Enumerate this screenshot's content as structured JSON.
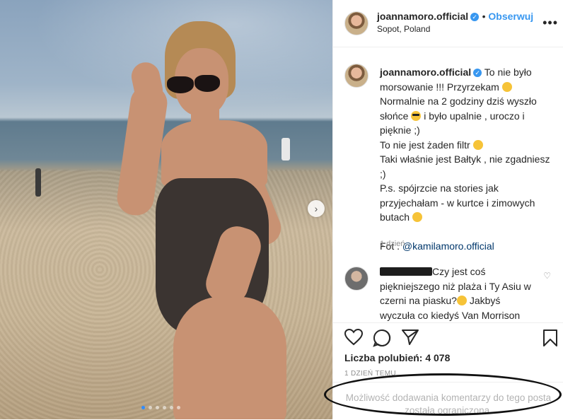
{
  "post": {
    "username": "joannamoro.official",
    "verified_mark": "✓",
    "follow_label": "Obserwuj",
    "location": "Sopot, Poland",
    "more_label": "•••"
  },
  "caption": {
    "username": "joannamoro.official",
    "line1": "To nie było morsowanie !!! Przyrzekam",
    "line2a": "Normalnie na 2 godziny dziś wyszło słońce",
    "line2b": "i było upalnie , uroczo i pięknie ;)",
    "line3": "To nie jest żaden filtr",
    "line4": "Taki właśnie jest Bałtyk , nie zgadniesz ;)",
    "line5": "P.s. spójrzcie na stories jak przyjechałam - w kurtce i zimowych butach",
    "credit_prefix": "Fot . ",
    "credit_tag": "@kamilamoro.official",
    "age": "1 dzień"
  },
  "comment": {
    "text": "Czy jest coś piękniejszego niż plaża i Ty Asiu w czerni na piasku?",
    "text2": "Jakbyś wyczuła co kiedyś Van Morrison"
  },
  "actions": {
    "likes": "Liczba polubień: 4 078",
    "timestamp": "1 DZIEŃ TEMU",
    "restricted": "Możliwość dodawania komentarzy do tego posta została ograniczona."
  },
  "icons": {
    "heart": "♡",
    "comment": "◯",
    "share": "➢",
    "bookmark": "⌑",
    "next": "›",
    "comment_like": "♡"
  },
  "carousel": {
    "slide_count": 6,
    "active_index": 0
  },
  "colors": {
    "accent": "#3897f0",
    "link": "#00376b",
    "muted": "#8e8e8e"
  }
}
